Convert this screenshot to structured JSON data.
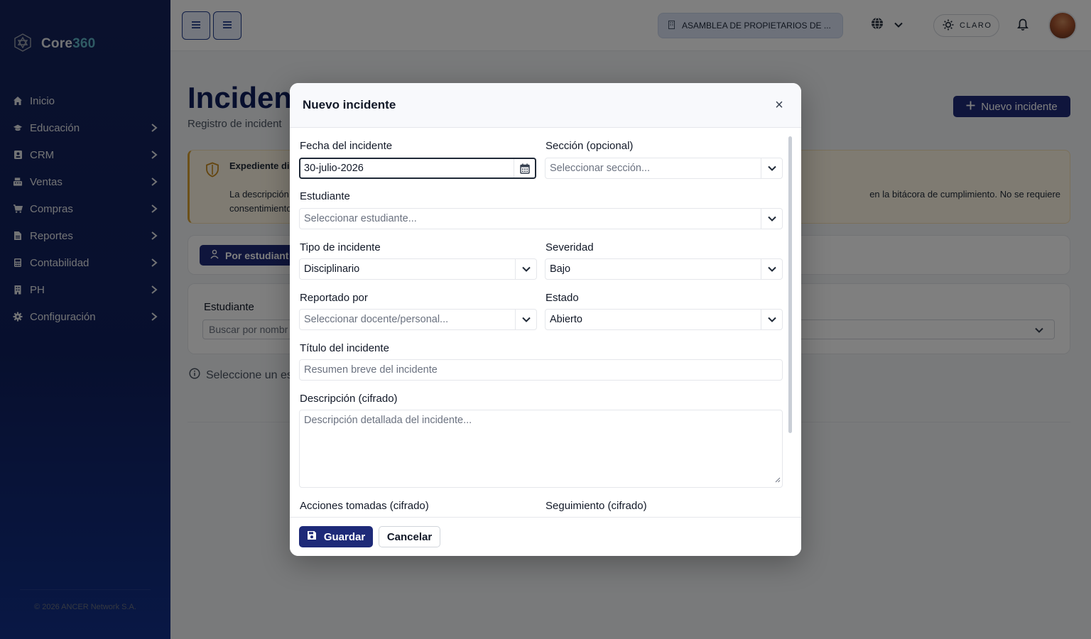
{
  "sidebar": {
    "brand": {
      "prefix": "Core",
      "accent": "360"
    },
    "items": [
      {
        "label": "Inicio",
        "icon": "home-icon",
        "has_children": false
      },
      {
        "label": "Educación",
        "icon": "graduation-cap-icon",
        "has_children": true
      },
      {
        "label": "CRM",
        "icon": "contact-card-icon",
        "has_children": true
      },
      {
        "label": "Ventas",
        "icon": "cash-register-icon",
        "has_children": true
      },
      {
        "label": "Compras",
        "icon": "shopping-cart-icon",
        "has_children": true
      },
      {
        "label": "Reportes",
        "icon": "file-icon",
        "has_children": true
      },
      {
        "label": "Contabilidad",
        "icon": "calculator-icon",
        "has_children": true
      },
      {
        "label": "PH",
        "icon": "building-icon",
        "has_children": true
      },
      {
        "label": "Configuración",
        "icon": "gear-icon",
        "has_children": true
      }
    ],
    "footer": "© 2026 ANCER Network S.A."
  },
  "topbar": {
    "organization": "ASAMBLEA DE PROPIETARIOS DE ...",
    "theme_label": "CLARO"
  },
  "page": {
    "title": "Inciden",
    "subtitle": "Registro de incident",
    "new_button": "Nuevo incidente",
    "notice": {
      "title": "Expediente dis",
      "body_left": "La descripción",
      "body_right": "en la bitácora de cumplimiento. No se requiere",
      "body_line2": "consentimiento"
    },
    "tab_active": "Por estudiant",
    "filter": {
      "label": "Estudiante",
      "placeholder": "Buscar por nombr"
    },
    "hint": "Seleccione un es"
  },
  "modal": {
    "title": "Nuevo incidente",
    "close": "×",
    "fields": {
      "date": {
        "label": "Fecha del incidente",
        "value": "30-julio-2026"
      },
      "section": {
        "label": "Sección (opcional)",
        "placeholder": "Seleccionar sección..."
      },
      "student": {
        "label": "Estudiante",
        "placeholder": "Seleccionar estudiante..."
      },
      "type": {
        "label": "Tipo de incidente",
        "value": "Disciplinario"
      },
      "severity": {
        "label": "Severidad",
        "value": "Bajo"
      },
      "reported_by": {
        "label": "Reportado por",
        "placeholder": "Seleccionar docente/personal..."
      },
      "status": {
        "label": "Estado",
        "value": "Abierto"
      },
      "title": {
        "label": "Título del incidente",
        "placeholder": "Resumen breve del incidente"
      },
      "description": {
        "label": "Descripción (cifrado)",
        "placeholder": "Descripción detallada del incidente..."
      },
      "actions": {
        "label": "Acciones tomadas (cifrado)"
      },
      "follow_up": {
        "label": "Seguimiento (cifrado)"
      }
    },
    "save_label": "Guardar",
    "cancel_label": "Cancelar"
  },
  "colors": {
    "primary": "#1e2a78",
    "sidebar_top": "#14235a",
    "accent": "#5fb6c9",
    "notice_bg": "#fef6e4",
    "notice_border": "#d9a033"
  }
}
